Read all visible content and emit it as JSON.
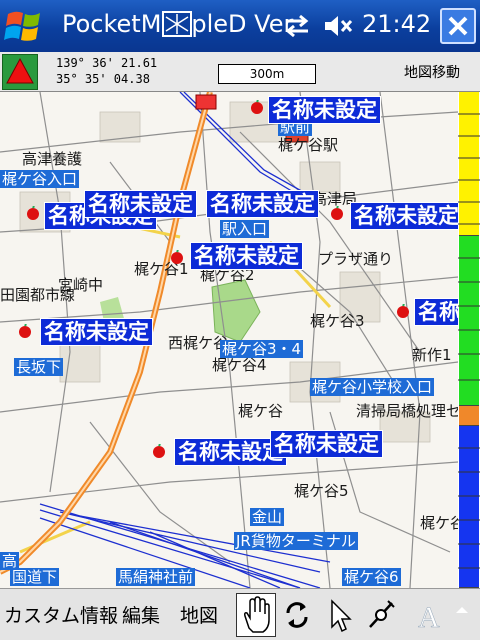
{
  "titlebar": {
    "title": "PocketMappleD Ver",
    "clock": "21:42"
  },
  "infobar": {
    "longitude": "139° 36' 21.61",
    "latitude": "35° 35' 04.38",
    "scale": "300m",
    "mode_label": "地図移動"
  },
  "map": {
    "poi_labels": [
      "名称未設定",
      "名称未設定",
      "名称未設定",
      "名称未設定",
      "名称未設定",
      "名称未設定",
      "名称未設定",
      "名称未設定",
      "名称未設定",
      "名称未設定",
      "名称未設定"
    ],
    "places": {
      "takatsu": "高津養護",
      "kajigaya_station": "梶ケ谷駅",
      "takatsu_post": "高津局",
      "kajigaya1": "梶ケ谷1",
      "kajigaya2": "梶ケ谷2",
      "kajigaya3": "梶ケ谷3",
      "kajigaya4": "梶ケ谷4",
      "kajigaya5": "梶ケ谷5",
      "kajigaya6": "梶ケ谷6",
      "kajigaya_plain": "梶ケ谷",
      "den_en_toshi": "田園都市線",
      "miyazaki": "宮崎中",
      "nishi": "西梶ケ谷",
      "shinsaku": "新作1",
      "seiso": "清掃局橋処理セ",
      "kajigaya_k": "梶ケ谷",
      "plaza": "プラザ通り"
    },
    "stations": {
      "kajigaya_entry": "梶ケ谷入口",
      "eki_entry": "駅入口",
      "ekimae": "駅前",
      "nagasaka": "長坂下",
      "kajigaya34": "梶ケ谷3・4",
      "school": "梶ケ谷小学校入口",
      "kanayama": "金山",
      "jr_terminal": "JR貨物ターミナル",
      "kokudo": "国道下",
      "umaginu": "馬絹神社前",
      "kajigaya6": "梶ケ谷6",
      "taka": "高"
    }
  },
  "toolbar": {
    "custom_info": "カスタム情報",
    "edit": "編集",
    "map": "地図"
  },
  "colors": {
    "poi_bg": "#0d2bd7",
    "station_bg": "#1e6bd6",
    "route": "#f08a2a",
    "north": "#2a9a3e"
  }
}
